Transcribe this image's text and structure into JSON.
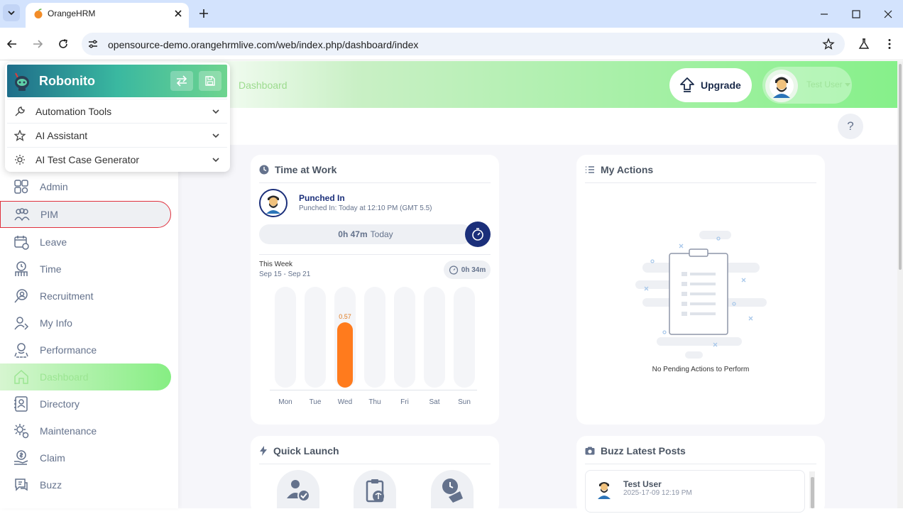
{
  "browser": {
    "tab_title": "OrangeHRM",
    "url": "opensource-demo.orangehrmlive.com/web/index.php/dashboard/index"
  },
  "header": {
    "breadcrumb": "Dashboard",
    "upgrade_label": "Upgrade",
    "user_name": "Test User",
    "help_label": "?"
  },
  "robonito": {
    "title": "Robonito",
    "items": [
      {
        "label": "Automation Tools"
      },
      {
        "label": "AI Assistant"
      },
      {
        "label": "AI Test Case Generator"
      }
    ]
  },
  "sidebar": {
    "items": [
      {
        "label": "Admin",
        "icon": "admin-icon"
      },
      {
        "label": "PIM",
        "icon": "pim-icon"
      },
      {
        "label": "Leave",
        "icon": "leave-icon"
      },
      {
        "label": "Time",
        "icon": "time-icon"
      },
      {
        "label": "Recruitment",
        "icon": "recruitment-icon"
      },
      {
        "label": "My Info",
        "icon": "my-info-icon"
      },
      {
        "label": "Performance",
        "icon": "performance-icon"
      },
      {
        "label": "Dashboard",
        "icon": "dashboard-icon"
      },
      {
        "label": "Directory",
        "icon": "directory-icon"
      },
      {
        "label": "Maintenance",
        "icon": "maintenance-icon"
      },
      {
        "label": "Claim",
        "icon": "claim-icon"
      },
      {
        "label": "Buzz",
        "icon": "buzz-icon"
      }
    ]
  },
  "time_at_work": {
    "title": "Time at Work",
    "status": "Punched In",
    "punched_detail": "Punched In: Today at 12:10 PM (GMT 5.5)",
    "today_duration": "0h 47m",
    "today_label": "Today",
    "week_label": "This Week",
    "week_range": "Sep 15 - Sep 21",
    "week_total": "0h 34m"
  },
  "chart_data": {
    "type": "bar",
    "categories": [
      "Mon",
      "Tue",
      "Wed",
      "Thu",
      "Fri",
      "Sat",
      "Sun"
    ],
    "values": [
      0,
      0,
      0.57,
      0,
      0,
      0,
      0
    ],
    "data_labels": [
      "",
      "",
      "0.57",
      "",
      "",
      "",
      ""
    ],
    "ylim": [
      0,
      0.57
    ],
    "bar_color": "#ff7b1d"
  },
  "my_actions": {
    "title": "My Actions",
    "empty_text": "No Pending Actions to Perform"
  },
  "quick_launch": {
    "title": "Quick Launch"
  },
  "buzz": {
    "title": "Buzz Latest Posts",
    "posts": [
      {
        "author": "Test User",
        "timestamp": "2025-17-09 12:19 PM"
      }
    ]
  },
  "colors": {
    "accent_green": "#86ee83",
    "punch_navy": "#1b2f7a",
    "pim_outline": "#e0313d"
  }
}
